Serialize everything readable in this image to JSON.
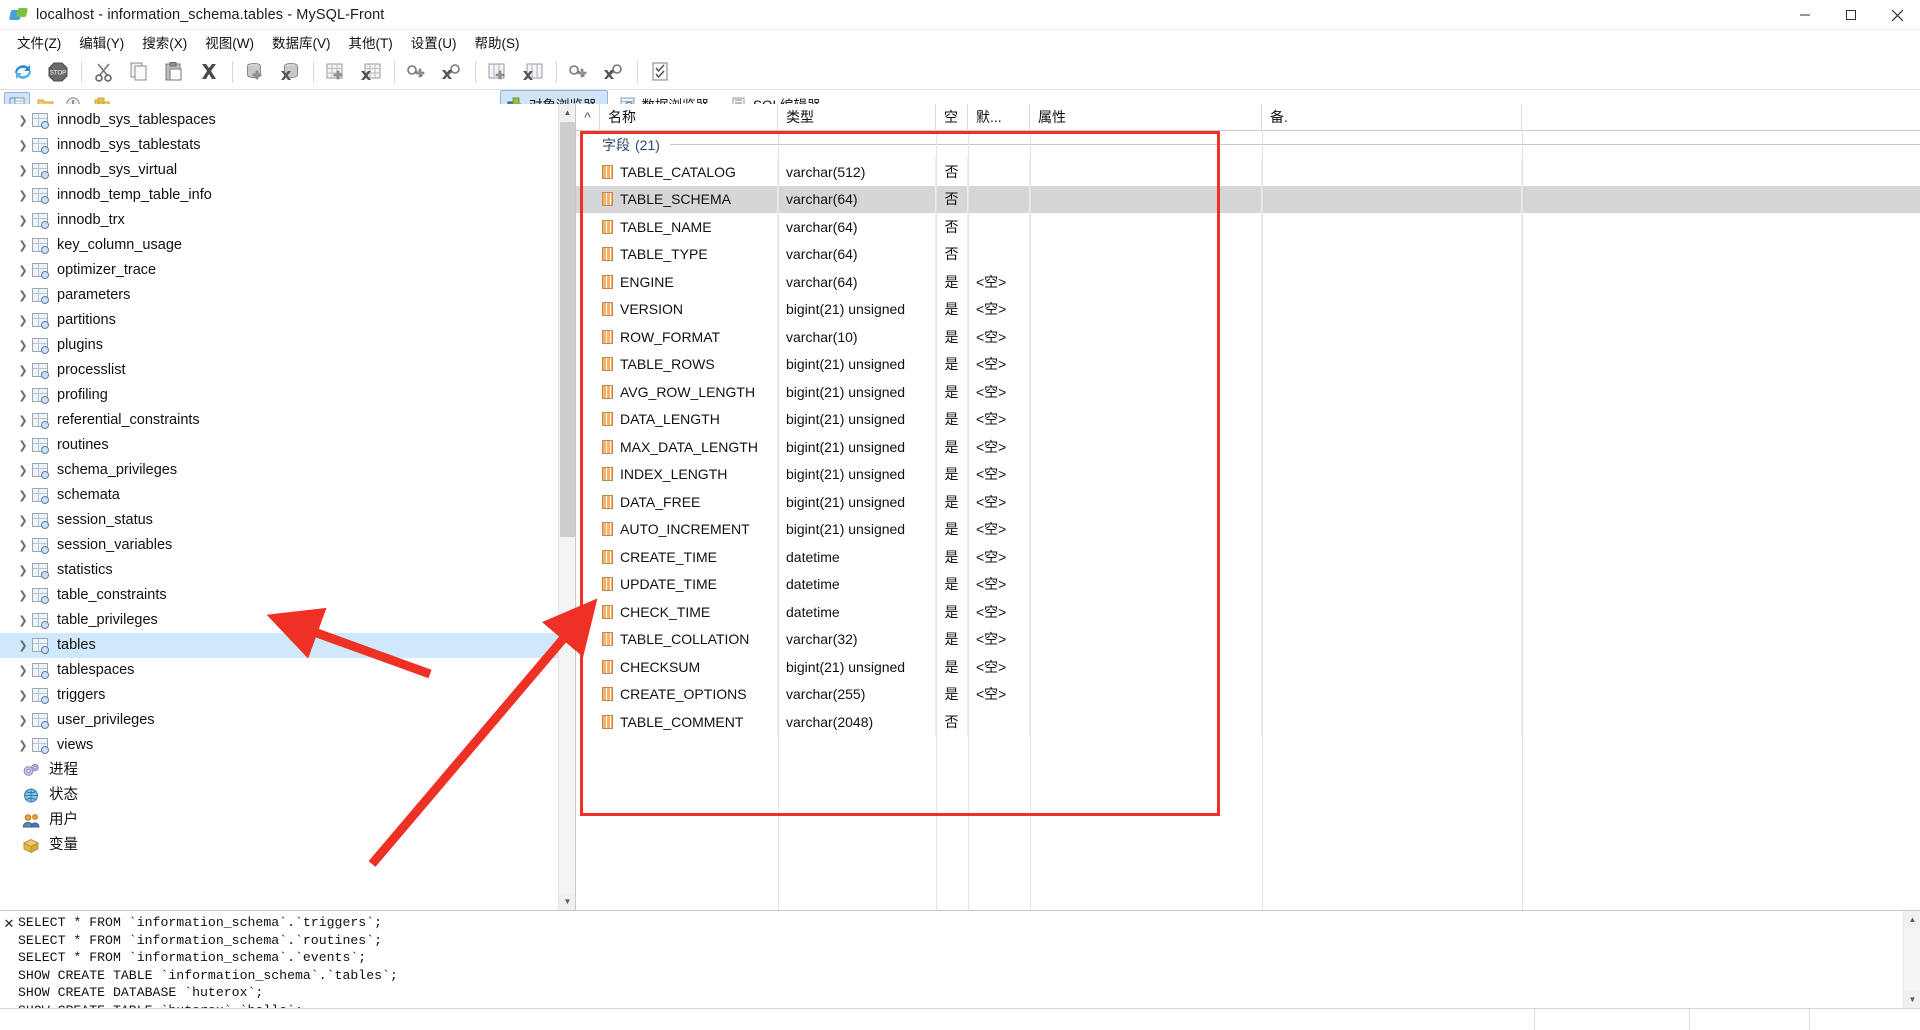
{
  "window": {
    "title": "localhost - information_schema.tables - MySQL-Front",
    "icon": "mysql-front-logo-icon",
    "minimize": "minimize-button",
    "maximize": "maximize-button",
    "close": "close-button"
  },
  "menubar": {
    "items": [
      {
        "label": "文件(Z)",
        "name": "menu-file"
      },
      {
        "label": "编辑(Y)",
        "name": "menu-edit"
      },
      {
        "label": "搜索(X)",
        "name": "menu-search"
      },
      {
        "label": "视图(W)",
        "name": "menu-view"
      },
      {
        "label": "数据库(V)",
        "name": "menu-database"
      },
      {
        "label": "其他(T)",
        "name": "menu-other"
      },
      {
        "label": "设置(U)",
        "name": "menu-settings"
      },
      {
        "label": "帮助(S)",
        "name": "menu-help"
      }
    ]
  },
  "toolbar": {
    "buttons": [
      {
        "name": "refresh-icon"
      },
      {
        "name": "stop-icon"
      },
      {
        "name": "cut-icon"
      },
      {
        "name": "copy-icon"
      },
      {
        "name": "paste-icon"
      },
      {
        "name": "delete-icon"
      },
      {
        "name": "add-database-icon"
      },
      {
        "name": "drop-database-icon"
      },
      {
        "name": "add-table-icon"
      },
      {
        "name": "drop-table-icon"
      },
      {
        "name": "add-key-icon"
      },
      {
        "name": "drop-key-icon"
      },
      {
        "name": "add-field-icon"
      },
      {
        "name": "drop-field-icon"
      },
      {
        "name": "add-index-icon"
      },
      {
        "name": "drop-index-icon"
      },
      {
        "name": "check-table-icon"
      }
    ]
  },
  "toolbar2": {
    "buttons": [
      {
        "name": "object-browser-icon",
        "active": true
      },
      {
        "name": "favorites-icon",
        "active": false
      },
      {
        "name": "history-icon",
        "active": false
      },
      {
        "name": "bookmark-icon",
        "active": false
      }
    ]
  },
  "tabs": [
    {
      "label": "对象浏览器",
      "name": "tab-object-browser",
      "icon": "object-browser-icon",
      "selected": true
    },
    {
      "label": "数据浏览器",
      "name": "tab-data-browser",
      "icon": "data-browser-icon",
      "selected": false
    },
    {
      "label": "SQL编辑器",
      "name": "tab-sql-editor",
      "icon": "sql-editor-icon",
      "selected": false
    }
  ],
  "tree": {
    "items": [
      {
        "label": "innodb_sys_tablespaces",
        "type": "table",
        "selected": false
      },
      {
        "label": "innodb_sys_tablestats",
        "type": "table",
        "selected": false
      },
      {
        "label": "innodb_sys_virtual",
        "type": "table",
        "selected": false
      },
      {
        "label": "innodb_temp_table_info",
        "type": "table",
        "selected": false
      },
      {
        "label": "innodb_trx",
        "type": "table",
        "selected": false
      },
      {
        "label": "key_column_usage",
        "type": "table",
        "selected": false
      },
      {
        "label": "optimizer_trace",
        "type": "table",
        "selected": false
      },
      {
        "label": "parameters",
        "type": "table",
        "selected": false
      },
      {
        "label": "partitions",
        "type": "table",
        "selected": false
      },
      {
        "label": "plugins",
        "type": "table",
        "selected": false
      },
      {
        "label": "processlist",
        "type": "table",
        "selected": false
      },
      {
        "label": "profiling",
        "type": "table",
        "selected": false
      },
      {
        "label": "referential_constraints",
        "type": "table",
        "selected": false
      },
      {
        "label": "routines",
        "type": "table",
        "selected": false
      },
      {
        "label": "schema_privileges",
        "type": "table",
        "selected": false
      },
      {
        "label": "schemata",
        "type": "table",
        "selected": false
      },
      {
        "label": "session_status",
        "type": "table",
        "selected": false
      },
      {
        "label": "session_variables",
        "type": "table",
        "selected": false
      },
      {
        "label": "statistics",
        "type": "table",
        "selected": false
      },
      {
        "label": "table_constraints",
        "type": "table",
        "selected": false
      },
      {
        "label": "table_privileges",
        "type": "table",
        "selected": false
      },
      {
        "label": "tables",
        "type": "table",
        "selected": true
      },
      {
        "label": "tablespaces",
        "type": "table",
        "selected": false
      },
      {
        "label": "triggers",
        "type": "table",
        "selected": false
      },
      {
        "label": "user_privileges",
        "type": "table",
        "selected": false
      },
      {
        "label": "views",
        "type": "table",
        "selected": false
      },
      {
        "label": "进程",
        "type": "leaf",
        "icon": "processes-icon",
        "selected": false
      },
      {
        "label": "状态",
        "type": "leaf",
        "icon": "status-globe-icon",
        "selected": false
      },
      {
        "label": "用户",
        "type": "leaf",
        "icon": "users-icon",
        "selected": false
      },
      {
        "label": "变量",
        "type": "leaf",
        "icon": "variables-box-icon",
        "selected": false
      }
    ]
  },
  "grid": {
    "headers": [
      "名称",
      "类型",
      "空",
      "默...",
      "属性",
      "备."
    ],
    "section": {
      "label": "字段",
      "count": "(21)"
    },
    "rows": [
      {
        "name": "TABLE_CATALOG",
        "type": "varchar(512)",
        "null": "否",
        "default": "",
        "attr": "",
        "comment": "",
        "selected": false
      },
      {
        "name": "TABLE_SCHEMA",
        "type": "varchar(64)",
        "null": "否",
        "default": "",
        "attr": "",
        "comment": "",
        "selected": true
      },
      {
        "name": "TABLE_NAME",
        "type": "varchar(64)",
        "null": "否",
        "default": "",
        "attr": "",
        "comment": "",
        "selected": false
      },
      {
        "name": "TABLE_TYPE",
        "type": "varchar(64)",
        "null": "否",
        "default": "",
        "attr": "",
        "comment": "",
        "selected": false
      },
      {
        "name": "ENGINE",
        "type": "varchar(64)",
        "null": "是",
        "default": "<空>",
        "attr": "",
        "comment": "",
        "selected": false
      },
      {
        "name": "VERSION",
        "type": "bigint(21) unsigned",
        "null": "是",
        "default": "<空>",
        "attr": "",
        "comment": "",
        "selected": false
      },
      {
        "name": "ROW_FORMAT",
        "type": "varchar(10)",
        "null": "是",
        "default": "<空>",
        "attr": "",
        "comment": "",
        "selected": false
      },
      {
        "name": "TABLE_ROWS",
        "type": "bigint(21) unsigned",
        "null": "是",
        "default": "<空>",
        "attr": "",
        "comment": "",
        "selected": false
      },
      {
        "name": "AVG_ROW_LENGTH",
        "type": "bigint(21) unsigned",
        "null": "是",
        "default": "<空>",
        "attr": "",
        "comment": "",
        "selected": false
      },
      {
        "name": "DATA_LENGTH",
        "type": "bigint(21) unsigned",
        "null": "是",
        "default": "<空>",
        "attr": "",
        "comment": "",
        "selected": false
      },
      {
        "name": "MAX_DATA_LENGTH",
        "type": "bigint(21) unsigned",
        "null": "是",
        "default": "<空>",
        "attr": "",
        "comment": "",
        "selected": false
      },
      {
        "name": "INDEX_LENGTH",
        "type": "bigint(21) unsigned",
        "null": "是",
        "default": "<空>",
        "attr": "",
        "comment": "",
        "selected": false
      },
      {
        "name": "DATA_FREE",
        "type": "bigint(21) unsigned",
        "null": "是",
        "default": "<空>",
        "attr": "",
        "comment": "",
        "selected": false
      },
      {
        "name": "AUTO_INCREMENT",
        "type": "bigint(21) unsigned",
        "null": "是",
        "default": "<空>",
        "attr": "",
        "comment": "",
        "selected": false
      },
      {
        "name": "CREATE_TIME",
        "type": "datetime",
        "null": "是",
        "default": "<空>",
        "attr": "",
        "comment": "",
        "selected": false
      },
      {
        "name": "UPDATE_TIME",
        "type": "datetime",
        "null": "是",
        "default": "<空>",
        "attr": "",
        "comment": "",
        "selected": false
      },
      {
        "name": "CHECK_TIME",
        "type": "datetime",
        "null": "是",
        "default": "<空>",
        "attr": "",
        "comment": "",
        "selected": false
      },
      {
        "name": "TABLE_COLLATION",
        "type": "varchar(32)",
        "null": "是",
        "default": "<空>",
        "attr": "",
        "comment": "",
        "selected": false
      },
      {
        "name": "CHECKSUM",
        "type": "bigint(21) unsigned",
        "null": "是",
        "default": "<空>",
        "attr": "",
        "comment": "",
        "selected": false
      },
      {
        "name": "CREATE_OPTIONS",
        "type": "varchar(255)",
        "null": "是",
        "default": "<空>",
        "attr": "",
        "comment": "",
        "selected": false
      },
      {
        "name": "TABLE_COMMENT",
        "type": "varchar(2048)",
        "null": "否",
        "default": "",
        "attr": "",
        "comment": "",
        "selected": false
      }
    ]
  },
  "annotations": {
    "rect_color": "#ee3124",
    "arrow_color": "#ee3124"
  },
  "log": {
    "close_label": "✕",
    "lines": [
      "SELECT * FROM `information_schema`.`triggers`;",
      "SELECT * FROM `information_schema`.`routines`;",
      "SELECT * FROM `information_schema`.`events`;",
      "SHOW CREATE TABLE `information_schema`.`tables`;",
      "SHOW CREATE DATABASE `huterox`;",
      "SHOW CREATE TABLE `huterox`.`hello`;"
    ]
  },
  "statusbar": {
    "cells": [
      "",
      "",
      "",
      ""
    ]
  }
}
